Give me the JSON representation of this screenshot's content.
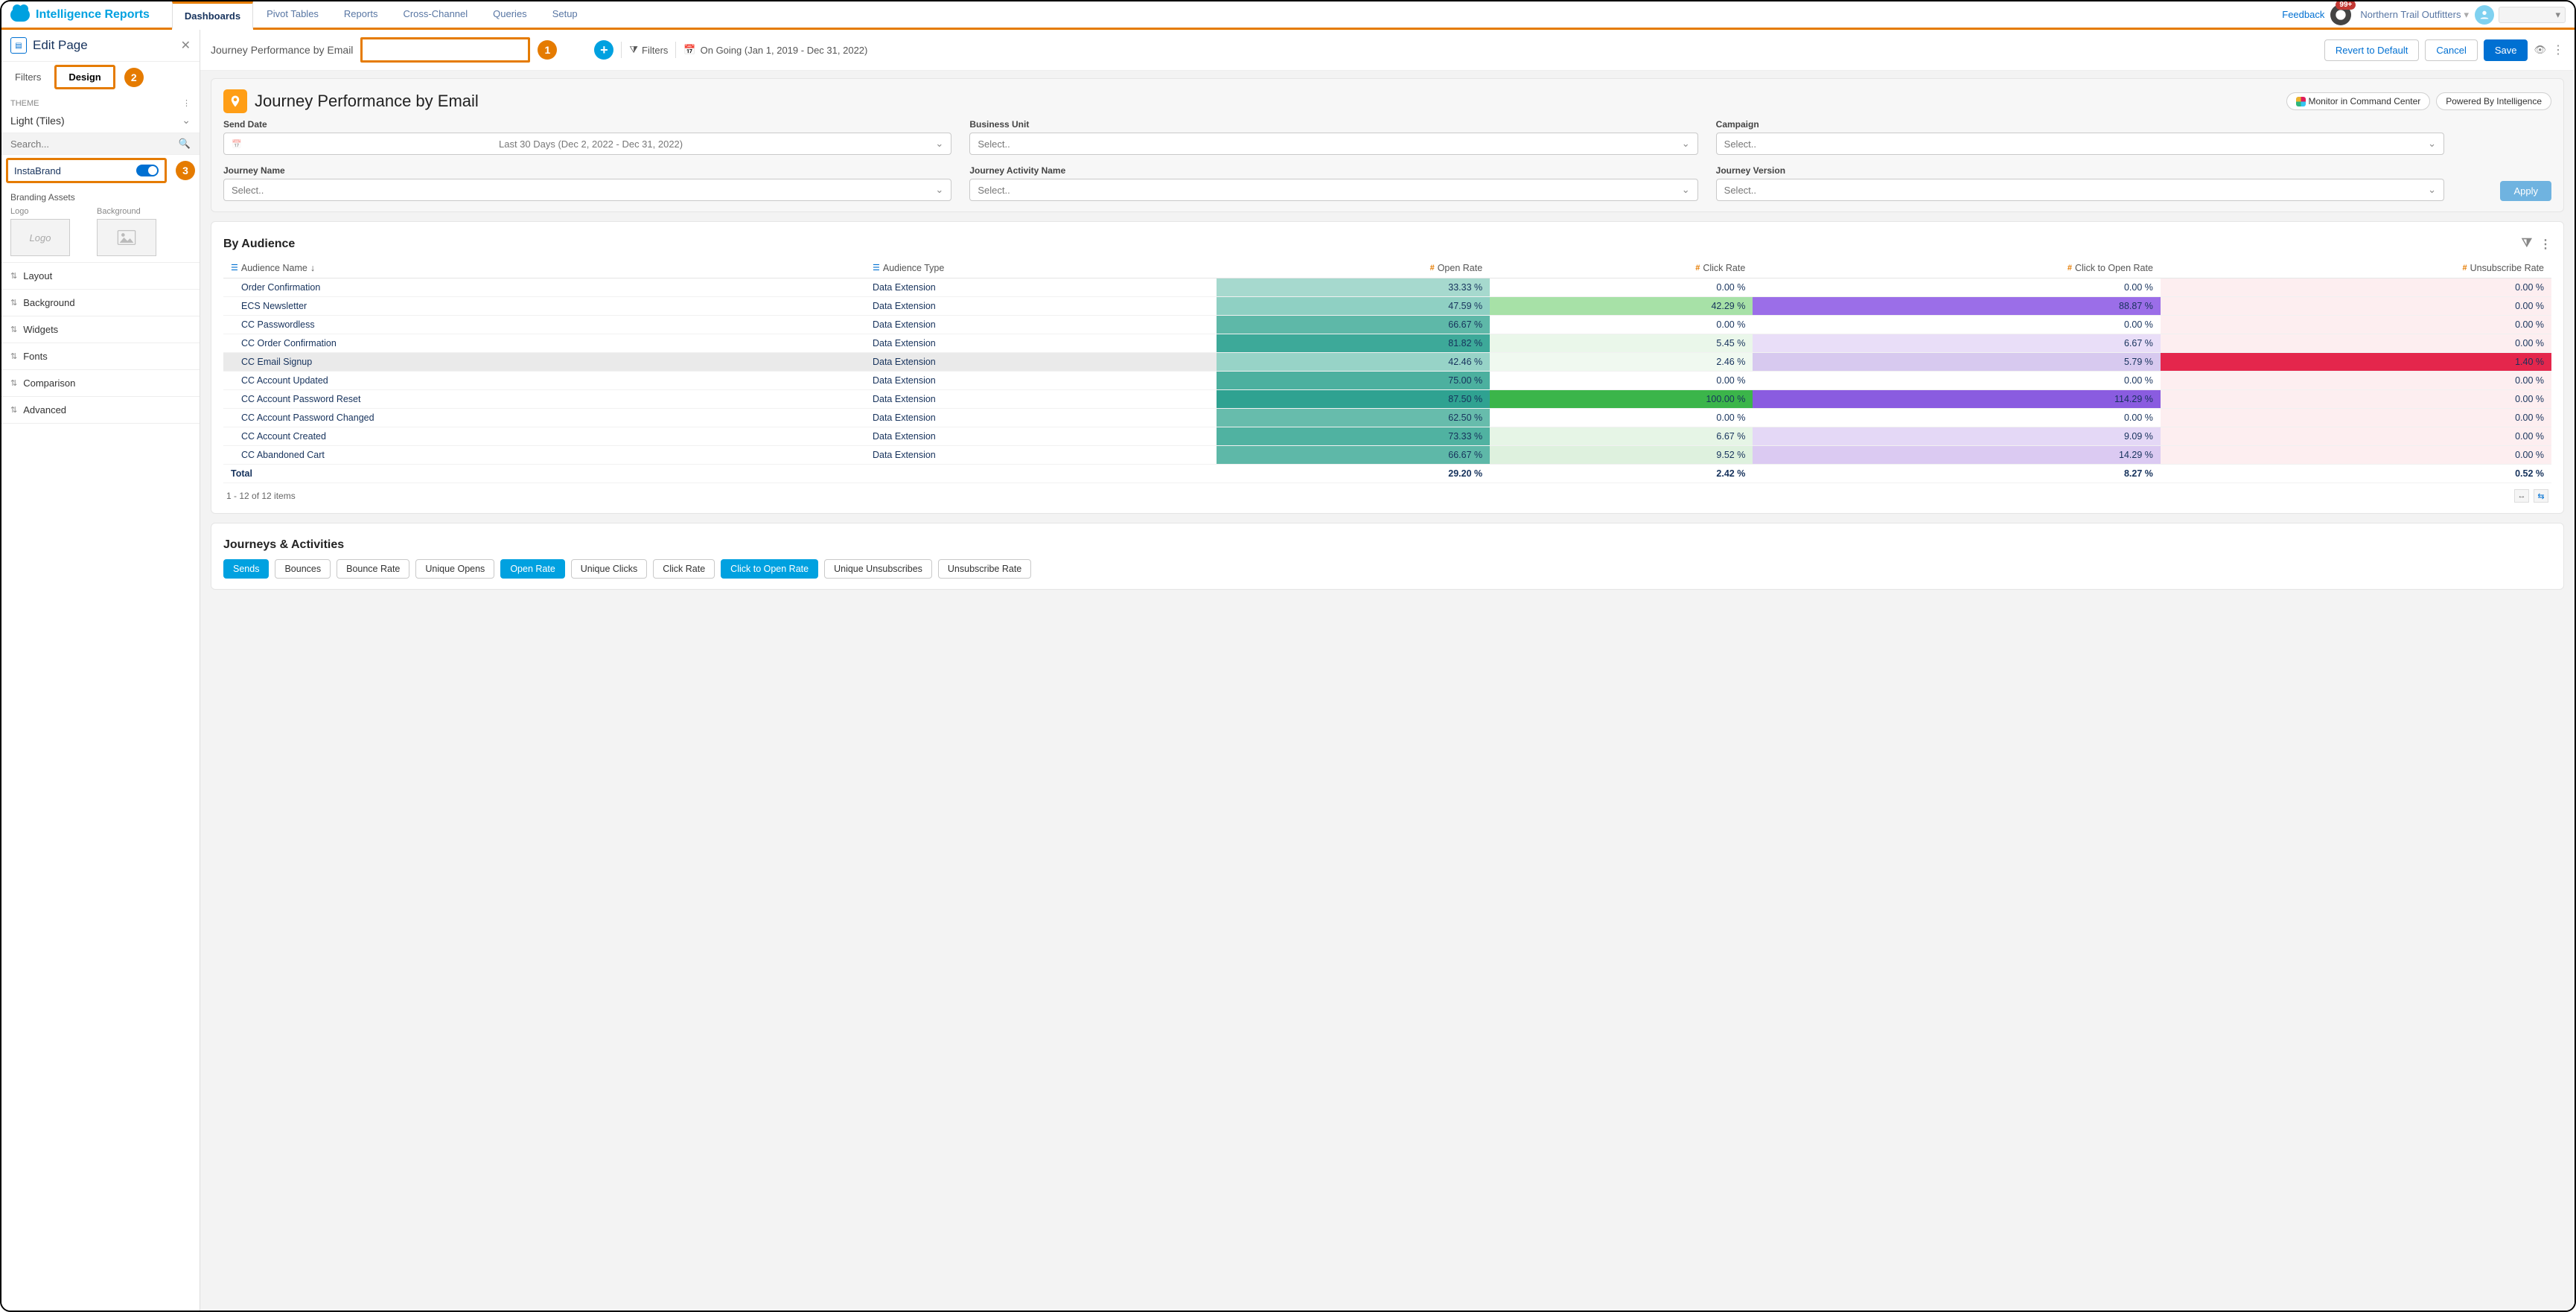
{
  "app": {
    "title": "Intelligence Reports"
  },
  "nav": {
    "tabs": [
      "Dashboards",
      "Pivot Tables",
      "Reports",
      "Cross-Channel",
      "Queries",
      "Setup"
    ],
    "active": 0,
    "feedback": "Feedback",
    "notif_badge": "99+",
    "org": "Northern Trail Outfitters"
  },
  "sidebar": {
    "title": "Edit Page",
    "tabs": {
      "filters": "Filters",
      "design": "Design"
    },
    "theme_label": "THEME",
    "theme_value": "Light (Tiles)",
    "search_placeholder": "Search...",
    "instabrand": "InstaBrand",
    "branding": {
      "heading": "Branding Assets",
      "logo": "Logo",
      "background": "Background",
      "logo_placeholder": "Logo"
    },
    "accordion": [
      "Layout",
      "Background",
      "Widgets",
      "Fonts",
      "Comparison",
      "Advanced"
    ]
  },
  "callouts": {
    "one": "1",
    "two": "2",
    "three": "3"
  },
  "toolbar": {
    "page_name": "Journey Performance by Email",
    "filters": "Filters",
    "date": "On Going (Jan 1, 2019 - Dec 31, 2022)",
    "revert": "Revert to Default",
    "cancel": "Cancel",
    "save": "Save"
  },
  "header_panel": {
    "title": "Journey Performance by Email",
    "monitor": "Monitor in Command Center",
    "powered": "Powered By Intelligence",
    "filters": {
      "send_date": {
        "label": "Send Date",
        "value": "Last 30 Days (Dec 2, 2022 - Dec 31, 2022)"
      },
      "business_unit": {
        "label": "Business Unit",
        "value": "Select.."
      },
      "campaign": {
        "label": "Campaign",
        "value": "Select.."
      },
      "journey_name": {
        "label": "Journey Name",
        "value": "Select.."
      },
      "journey_activity": {
        "label": "Journey Activity Name",
        "value": "Select.."
      },
      "journey_version": {
        "label": "Journey Version",
        "value": "Select.."
      }
    },
    "apply": "Apply"
  },
  "audience": {
    "title": "By Audience",
    "cols": {
      "name": "Audience Name",
      "type": "Audience Type",
      "open": "Open Rate",
      "click": "Click Rate",
      "cto": "Click to Open Rate",
      "unsub": "Unsubscribe Rate"
    },
    "rows": [
      {
        "name": "Order Confirmation",
        "type": "Data Extension",
        "open": "33.33 %",
        "click": "0.00 %",
        "cto": "0.00 %",
        "unsub": "0.00 %",
        "oc": "#a6d9ce",
        "cc": "#ffffff",
        "tc": "#ffffff",
        "uc": "#fdeef0"
      },
      {
        "name": "ECS Newsletter",
        "type": "Data Extension",
        "open": "47.59 %",
        "click": "42.29 %",
        "cto": "88.87 %",
        "unsub": "0.00 %",
        "oc": "#8fd0c3",
        "cc": "#a7e1a7",
        "tc": "#9b6ee8",
        "uc": "#fdeef0"
      },
      {
        "name": "CC Passwordless",
        "type": "Data Extension",
        "open": "66.67 %",
        "click": "0.00 %",
        "cto": "0.00 %",
        "unsub": "0.00 %",
        "oc": "#5eb8a8",
        "cc": "#ffffff",
        "tc": "#ffffff",
        "uc": "#fdeef0"
      },
      {
        "name": "CC Order Confirmation",
        "type": "Data Extension",
        "open": "81.82 %",
        "click": "5.45 %",
        "cto": "6.67 %",
        "unsub": "0.00 %",
        "oc": "#3da999",
        "cc": "#eaf7ea",
        "tc": "#e9def8",
        "uc": "#fdeef0"
      },
      {
        "name": "CC Email Signup",
        "type": "Data Extension",
        "open": "42.46 %",
        "click": "2.46 %",
        "cto": "5.79 %",
        "unsub": "1.40 %",
        "oc": "#97d3c7",
        "cc": "#f0f9f0",
        "tc": "#d7c9ef",
        "uc": "#e4264c",
        "sel": true
      },
      {
        "name": "CC Account Updated",
        "type": "Data Extension",
        "open": "75.00 %",
        "click": "0.00 %",
        "cto": "0.00 %",
        "unsub": "0.00 %",
        "oc": "#4cb09f",
        "cc": "#ffffff",
        "tc": "#ffffff",
        "uc": "#fdeef0"
      },
      {
        "name": "CC Account Password Reset",
        "type": "Data Extension",
        "open": "87.50 %",
        "click": "100.00 %",
        "cto": "114.29 %",
        "unsub": "0.00 %",
        "oc": "#2fa291",
        "cc": "#3bb54a",
        "tc": "#8a5ce0",
        "uc": "#fdeef0"
      },
      {
        "name": "CC Account Password Changed",
        "type": "Data Extension",
        "open": "62.50 %",
        "click": "0.00 %",
        "cto": "0.00 %",
        "unsub": "0.00 %",
        "oc": "#67bcac",
        "cc": "#ffffff",
        "tc": "#ffffff",
        "uc": "#fdeef0"
      },
      {
        "name": "CC Account Created",
        "type": "Data Extension",
        "open": "73.33 %",
        "click": "6.67 %",
        "cto": "9.09 %",
        "unsub": "0.00 %",
        "oc": "#50b2a1",
        "cc": "#e6f5e6",
        "tc": "#e4d8f6",
        "uc": "#fdeef0"
      },
      {
        "name": "CC Abandoned Cart",
        "type": "Data Extension",
        "open": "66.67 %",
        "click": "9.52 %",
        "cto": "14.29 %",
        "unsub": "0.00 %",
        "oc": "#5eb8a8",
        "cc": "#def1de",
        "tc": "#dbcaf2",
        "uc": "#fdeef0"
      }
    ],
    "total": {
      "label": "Total",
      "open": "29.20 %",
      "click": "2.42 %",
      "cto": "8.27 %",
      "unsub": "0.52 %"
    },
    "pager": "1 - 12 of 12 items"
  },
  "journeys": {
    "title": "Journeys & Activities",
    "chips": [
      "Sends",
      "Bounces",
      "Bounce Rate",
      "Unique Opens",
      "Open Rate",
      "Unique Clicks",
      "Click Rate",
      "Click to Open Rate",
      "Unique Unsubscribes",
      "Unsubscribe Rate"
    ],
    "active": [
      0,
      4,
      7
    ]
  }
}
